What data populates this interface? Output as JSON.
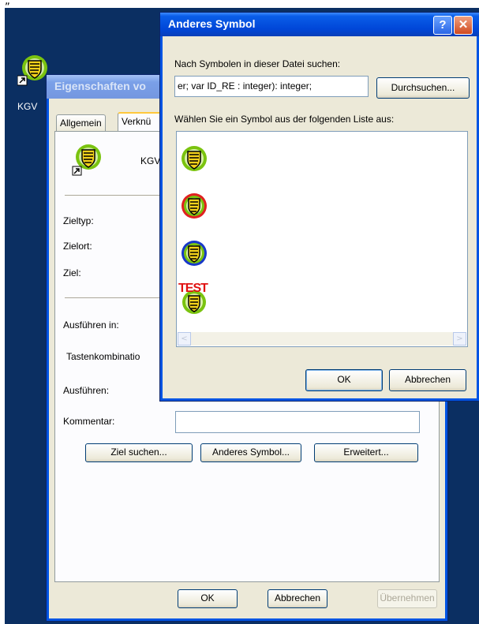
{
  "top_note": "„",
  "desktop": {
    "icon_label": "KGV"
  },
  "properties_window": {
    "title": "Eigenschaften vo",
    "tabs": [
      "Allgemein",
      "Verknü"
    ],
    "shortcut_name": "KGV",
    "labels": {
      "zieltyp": "Zieltyp:",
      "zielort": "Zielort:",
      "ziel": "Ziel:",
      "ausfuehren_in": "Ausführen in:",
      "tastenkombination": "Tastenkombinatio",
      "ausfuehren": "Ausführen:",
      "kommentar": "Kommentar:"
    },
    "kommentar_value": "",
    "buttons": {
      "ziel_suchen": "Ziel suchen...",
      "anderes_symbol": "Anderes Symbol...",
      "erweitert": "Erweitert..."
    },
    "footer_buttons": {
      "ok": "OK",
      "abbrechen": "Abbrechen",
      "uebernehmen": "Übernehmen"
    }
  },
  "change_icon_dialog": {
    "title": "Anderes Symbol",
    "help_button": "?",
    "close_button": "✕",
    "search_label": "Nach Symbolen in dieser Datei suchen:",
    "file_value": "er; var ID_RE : integer): integer;",
    "browse_button": "Durchsuchen...",
    "list_label": "Wählen Sie ein Symbol aus der folgenden Liste aus:",
    "icons": [
      {
        "name": "green-shield-icon",
        "ring": "#7ac30f"
      },
      {
        "name": "red-ring-shield-icon",
        "ring": "#e02020"
      },
      {
        "name": "blue-ring-shield-icon",
        "ring": "#1838c8"
      },
      {
        "name": "test-shield-icon",
        "ring": "#7ac30f",
        "overlay": "TEST"
      }
    ],
    "scroll_left": "<",
    "scroll_right": ">",
    "ok": "OK",
    "cancel": "Abbrechen"
  },
  "colors": {
    "desktop": "#0b2f62",
    "xp_title_blue": "#0046d8",
    "dialog_face": "#ece9d8"
  }
}
